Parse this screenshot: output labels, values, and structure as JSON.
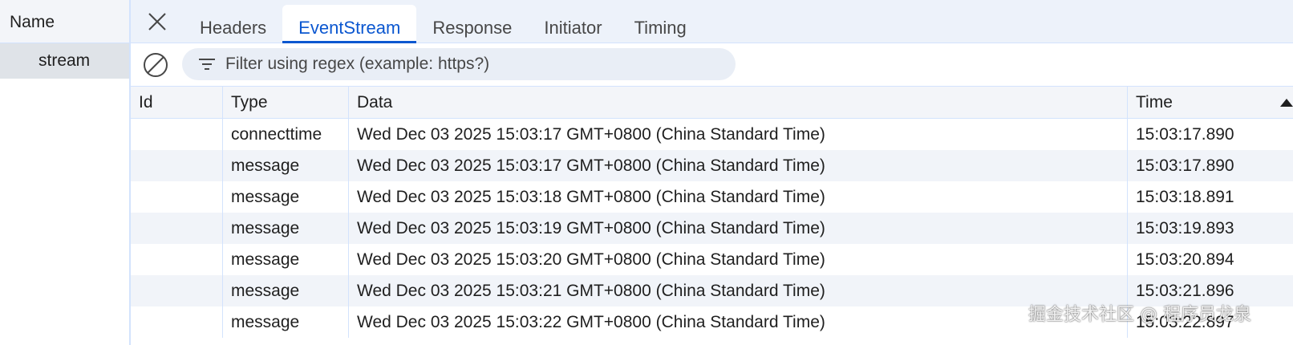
{
  "left_panel": {
    "header": "Name",
    "items": [
      {
        "name": "stream",
        "selected": true
      }
    ]
  },
  "tabs": [
    {
      "label": "Headers",
      "active": false
    },
    {
      "label": "EventStream",
      "active": true
    },
    {
      "label": "Response",
      "active": false
    },
    {
      "label": "Initiator",
      "active": false
    },
    {
      "label": "Timing",
      "active": false
    }
  ],
  "toolbar": {
    "clear_icon": "clear-circle-slash-icon",
    "filter_icon": "filter-lines-icon",
    "filter_placeholder": "Filter using regex (example: https?)"
  },
  "table": {
    "columns": [
      "Id",
      "Type",
      "Data",
      "Time"
    ],
    "sort_column": "Time",
    "sort_direction": "ascending",
    "rows": [
      {
        "id": "",
        "type": "connecttime",
        "data": "Wed Dec 03 2025 15:03:17 GMT+0800 (China Standard Time)",
        "time": "15:03:17.890"
      },
      {
        "id": "",
        "type": "message",
        "data": "Wed Dec 03 2025 15:03:17 GMT+0800 (China Standard Time)",
        "time": "15:03:17.890"
      },
      {
        "id": "",
        "type": "message",
        "data": "Wed Dec 03 2025 15:03:18 GMT+0800 (China Standard Time)",
        "time": "15:03:18.891"
      },
      {
        "id": "",
        "type": "message",
        "data": "Wed Dec 03 2025 15:03:19 GMT+0800 (China Standard Time)",
        "time": "15:03:19.893"
      },
      {
        "id": "",
        "type": "message",
        "data": "Wed Dec 03 2025 15:03:20 GMT+0800 (China Standard Time)",
        "time": "15:03:20.894"
      },
      {
        "id": "",
        "type": "message",
        "data": "Wed Dec 03 2025 15:03:21 GMT+0800 (China Standard Time)",
        "time": "15:03:21.896"
      },
      {
        "id": "",
        "type": "message",
        "data": "Wed Dec 03 2025 15:03:22 GMT+0800 (China Standard Time)",
        "time": "15:03:22.897"
      }
    ]
  },
  "watermark": "掘金技术社区 @ 程序员龙泉",
  "colors": {
    "accent": "#0b57d0",
    "tabbar_bg": "#edf2fa",
    "row_stripe": "#f1f4f9",
    "divider": "#d3e3fd",
    "selected_row": "#dfe3e8"
  }
}
